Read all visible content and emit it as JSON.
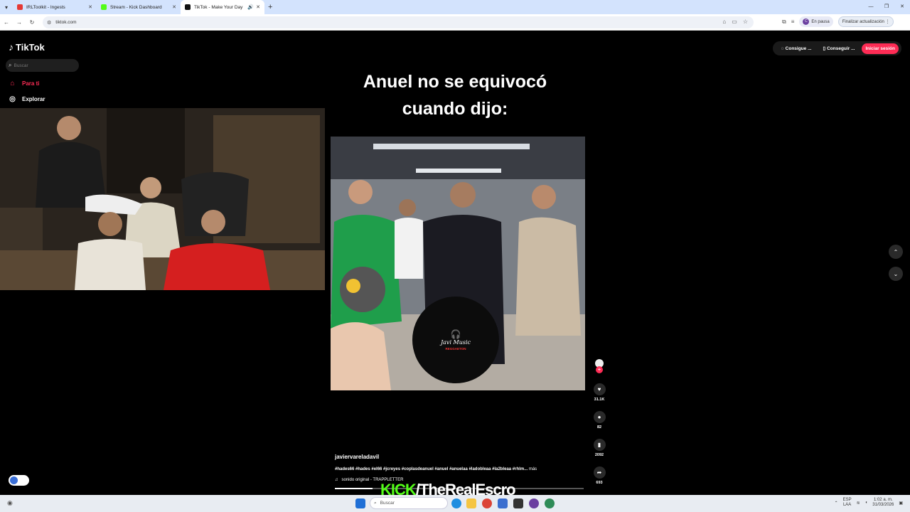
{
  "browser": {
    "tabs": [
      {
        "title": "IRLToolkit - Ingests",
        "color": "#e53935"
      },
      {
        "title": "Stream - Kick Dashboard",
        "color": "#53fc18"
      },
      {
        "title": "TikTok - Make Your Day",
        "color": "#111111"
      }
    ],
    "url": "tiktok.com",
    "profile_label": "En pausa",
    "profile_initial": "C",
    "update_label": "Finalizar actualización"
  },
  "tiktok": {
    "logo_text": "TikTok",
    "search_placeholder": "Buscar",
    "nav": [
      {
        "label": "Para ti",
        "color": "#fe2c55"
      },
      {
        "label": "Explorar",
        "color": "#ffffff"
      }
    ],
    "top_buttons": [
      "Consigue ...",
      "Conseguir ..."
    ],
    "login_label": "Iniciar sesión"
  },
  "video": {
    "caption_line1": "Anuel no se equivocó",
    "caption_line2": "cuando dijo:",
    "watermark_title": "Javi Music",
    "watermark_sub": "REGGAETON",
    "author": "javiervareladavil",
    "tags": "#hades66 #hades #el66 #jcreyes #coplasdeanuel #anuel #anuelaa #ladobleaa #la2bleaa #rhlm...",
    "more": "más",
    "sound": "sonido original - TRAPPLETTER",
    "progress": 0.15
  },
  "actions": {
    "likes": "31.1K",
    "comments": "82",
    "saves": "2092",
    "shares": "693"
  },
  "overlay": {
    "kick_brand": "KICK",
    "channel": "/TheRealEscro"
  },
  "taskbar": {
    "search_placeholder": "Buscar",
    "lang_top": "ESP",
    "lang_bottom": "LAA",
    "time": "1:02 a. m.",
    "date": "31/03/2026"
  }
}
